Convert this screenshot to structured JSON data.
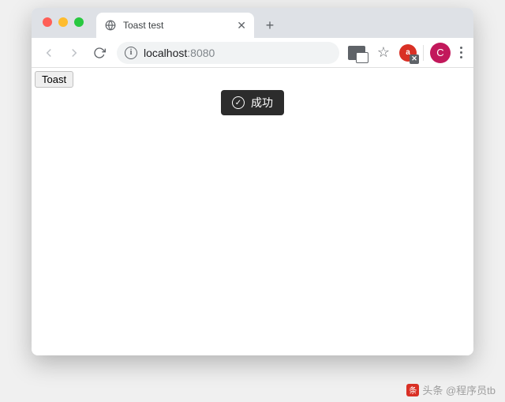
{
  "tab": {
    "title": "Toast test"
  },
  "addressbar": {
    "host": "localhost",
    "port": ":8080"
  },
  "avatar": {
    "initial": "C"
  },
  "extension_badge": {
    "label": "a"
  },
  "page": {
    "button_label": "Toast",
    "toast_message": "成功"
  },
  "watermark": {
    "text": "头条 @程序员tb"
  }
}
